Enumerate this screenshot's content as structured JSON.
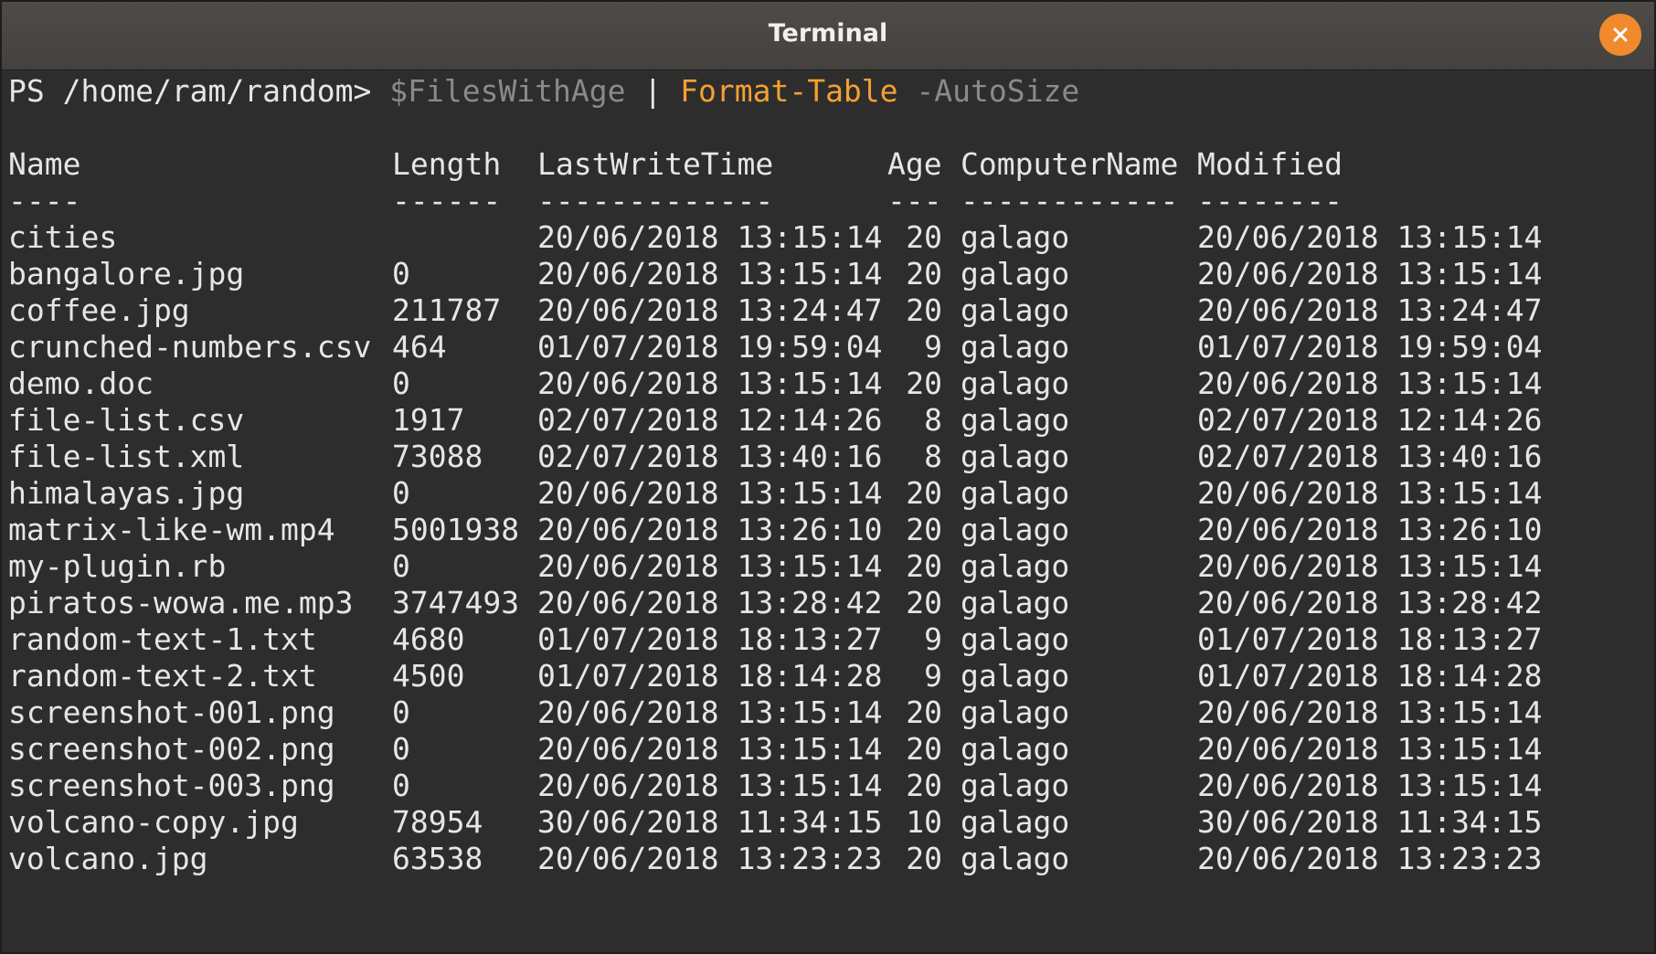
{
  "window": {
    "title": "Terminal",
    "close_icon": "close-icon",
    "accent_color": "#f08a2c"
  },
  "prompt": {
    "ps": "PS /home/ram/random> ",
    "variable": "$FilesWithAge",
    "pipe": " | ",
    "cmdlet": "Format-Table",
    "parameter": " -AutoSize"
  },
  "table": {
    "headers": [
      "Name",
      "Length",
      "LastWriteTime",
      "Age",
      "ComputerName",
      "Modified"
    ],
    "separators": [
      "----",
      "------",
      "-------------",
      "---",
      "------------",
      "--------"
    ],
    "rows": [
      [
        "cities",
        "",
        "20/06/2018 13:15:14",
        "20",
        "galago",
        "20/06/2018 13:15:14"
      ],
      [
        "bangalore.jpg",
        "0",
        "20/06/2018 13:15:14",
        "20",
        "galago",
        "20/06/2018 13:15:14"
      ],
      [
        "coffee.jpg",
        "211787",
        "20/06/2018 13:24:47",
        "20",
        "galago",
        "20/06/2018 13:24:47"
      ],
      [
        "crunched-numbers.csv",
        "464",
        "01/07/2018 19:59:04",
        "9",
        "galago",
        "01/07/2018 19:59:04"
      ],
      [
        "demo.doc",
        "0",
        "20/06/2018 13:15:14",
        "20",
        "galago",
        "20/06/2018 13:15:14"
      ],
      [
        "file-list.csv",
        "1917",
        "02/07/2018 12:14:26",
        "8",
        "galago",
        "02/07/2018 12:14:26"
      ],
      [
        "file-list.xml",
        "73088",
        "02/07/2018 13:40:16",
        "8",
        "galago",
        "02/07/2018 13:40:16"
      ],
      [
        "himalayas.jpg",
        "0",
        "20/06/2018 13:15:14",
        "20",
        "galago",
        "20/06/2018 13:15:14"
      ],
      [
        "matrix-like-wm.mp4",
        "5001938",
        "20/06/2018 13:26:10",
        "20",
        "galago",
        "20/06/2018 13:26:10"
      ],
      [
        "my-plugin.rb",
        "0",
        "20/06/2018 13:15:14",
        "20",
        "galago",
        "20/06/2018 13:15:14"
      ],
      [
        "piratos-wowa.me.mp3",
        "3747493",
        "20/06/2018 13:28:42",
        "20",
        "galago",
        "20/06/2018 13:28:42"
      ],
      [
        "random-text-1.txt",
        "4680",
        "01/07/2018 18:13:27",
        "9",
        "galago",
        "01/07/2018 18:13:27"
      ],
      [
        "random-text-2.txt",
        "4500",
        "01/07/2018 18:14:28",
        "9",
        "galago",
        "01/07/2018 18:14:28"
      ],
      [
        "screenshot-001.png",
        "0",
        "20/06/2018 13:15:14",
        "20",
        "galago",
        "20/06/2018 13:15:14"
      ],
      [
        "screenshot-002.png",
        "0",
        "20/06/2018 13:15:14",
        "20",
        "galago",
        "20/06/2018 13:15:14"
      ],
      [
        "screenshot-003.png",
        "0",
        "20/06/2018 13:15:14",
        "20",
        "galago",
        "20/06/2018 13:15:14"
      ],
      [
        "volcano-copy.jpg",
        "78954",
        "30/06/2018 11:34:15",
        "10",
        "galago",
        "30/06/2018 11:34:15"
      ],
      [
        "volcano.jpg",
        "63538",
        "20/06/2018 13:23:23",
        "20",
        "galago",
        "20/06/2018 13:23:23"
      ]
    ]
  }
}
